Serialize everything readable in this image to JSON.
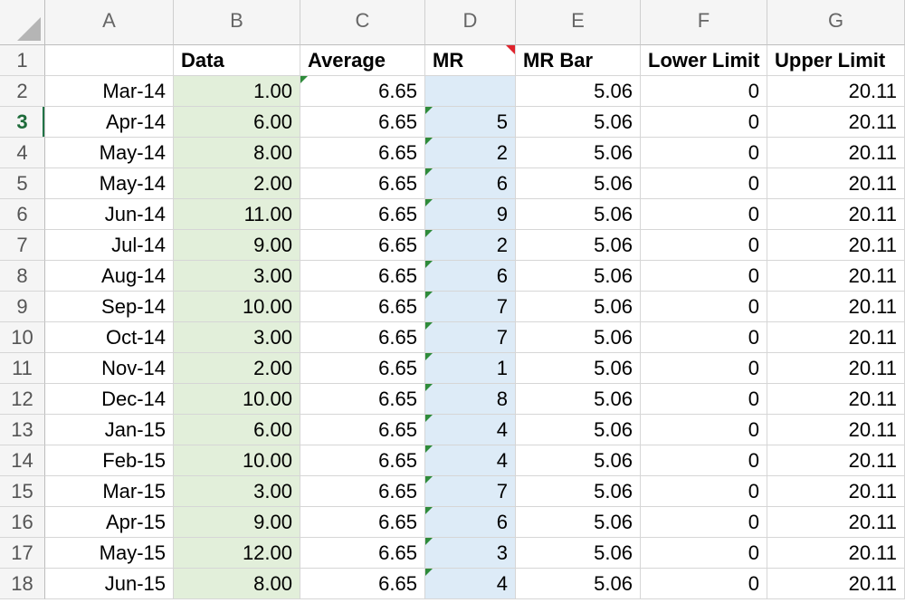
{
  "columns": [
    "A",
    "B",
    "C",
    "D",
    "E",
    "F",
    "G"
  ],
  "header_row": [
    "",
    "Data",
    "Average",
    "MR",
    "MR Bar",
    "Lower Limit",
    "Upper Limit"
  ],
  "active_row": 3,
  "rows": [
    [
      "Mar-14",
      "1.00",
      "6.65",
      "",
      "5.06",
      "0",
      "20.11"
    ],
    [
      "Apr-14",
      "6.00",
      "6.65",
      "5",
      "5.06",
      "0",
      "20.11"
    ],
    [
      "May-14",
      "8.00",
      "6.65",
      "2",
      "5.06",
      "0",
      "20.11"
    ],
    [
      "May-14",
      "2.00",
      "6.65",
      "6",
      "5.06",
      "0",
      "20.11"
    ],
    [
      "Jun-14",
      "11.00",
      "6.65",
      "9",
      "5.06",
      "0",
      "20.11"
    ],
    [
      "Jul-14",
      "9.00",
      "6.65",
      "2",
      "5.06",
      "0",
      "20.11"
    ],
    [
      "Aug-14",
      "3.00",
      "6.65",
      "6",
      "5.06",
      "0",
      "20.11"
    ],
    [
      "Sep-14",
      "10.00",
      "6.65",
      "7",
      "5.06",
      "0",
      "20.11"
    ],
    [
      "Oct-14",
      "3.00",
      "6.65",
      "7",
      "5.06",
      "0",
      "20.11"
    ],
    [
      "Nov-14",
      "2.00",
      "6.65",
      "1",
      "5.06",
      "0",
      "20.11"
    ],
    [
      "Dec-14",
      "10.00",
      "6.65",
      "8",
      "5.06",
      "0",
      "20.11"
    ],
    [
      "Jan-15",
      "6.00",
      "6.65",
      "4",
      "5.06",
      "0",
      "20.11"
    ],
    [
      "Feb-15",
      "10.00",
      "6.65",
      "4",
      "5.06",
      "0",
      "20.11"
    ],
    [
      "Mar-15",
      "3.00",
      "6.65",
      "7",
      "5.06",
      "0",
      "20.11"
    ],
    [
      "Apr-15",
      "9.00",
      "6.65",
      "6",
      "5.06",
      "0",
      "20.11"
    ],
    [
      "May-15",
      "12.00",
      "6.65",
      "3",
      "5.06",
      "0",
      "20.11"
    ],
    [
      "Jun-15",
      "8.00",
      "6.65",
      "4",
      "5.06",
      "0",
      "20.11"
    ]
  ],
  "colors": {
    "data_fill": "#e2efda",
    "mr_fill": "#ddebf7",
    "active_row_header": "#217346",
    "error_flag": "#2e8b3a",
    "comment_flag": "#e0242d"
  }
}
